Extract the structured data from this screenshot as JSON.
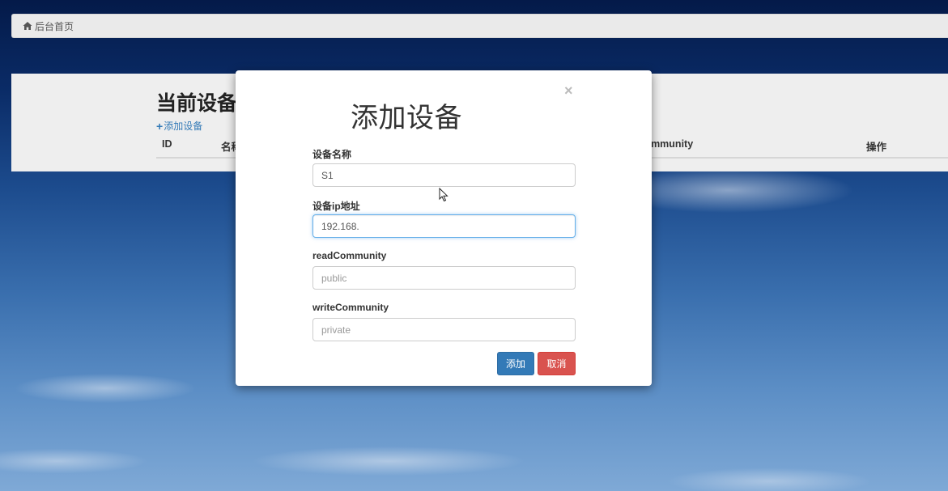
{
  "breadcrumb": {
    "home_label": "后台首页",
    "icon": "home-icon"
  },
  "page": {
    "title": "当前设备",
    "add_link": "添加设备",
    "table_headers": [
      "ID",
      "名称",
      "readCommunity",
      "操作"
    ]
  },
  "modal": {
    "title": "添加设备",
    "close": "×",
    "fields": [
      {
        "label": "设备名称",
        "value": "S1",
        "placeholder": ""
      },
      {
        "label": "设备ip地址",
        "value": "192.168.",
        "placeholder": ""
      },
      {
        "label": "readCommunity",
        "value": "",
        "placeholder": "public"
      },
      {
        "label": "writeCommunity",
        "value": "",
        "placeholder": "private"
      }
    ],
    "submit_label": "添加",
    "cancel_label": "取消"
  },
  "colors": {
    "primary": "#337ab7",
    "danger": "#d9534f",
    "focus": "#66afe9"
  }
}
